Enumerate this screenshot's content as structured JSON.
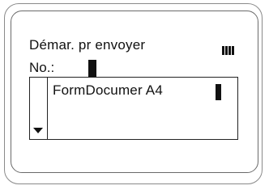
{
  "screen": {
    "title": "Démar. pr envoyer",
    "number_label": "No.:",
    "signal_icon": "signal-strength-icon",
    "list": {
      "items": [
        {
          "label": "FormDocumer A4"
        }
      ],
      "scroll_icon": "triangle-down-icon"
    }
  },
  "colors": {
    "text": "#111111",
    "background": "#ffffff",
    "frame": "#8a8a8a"
  }
}
